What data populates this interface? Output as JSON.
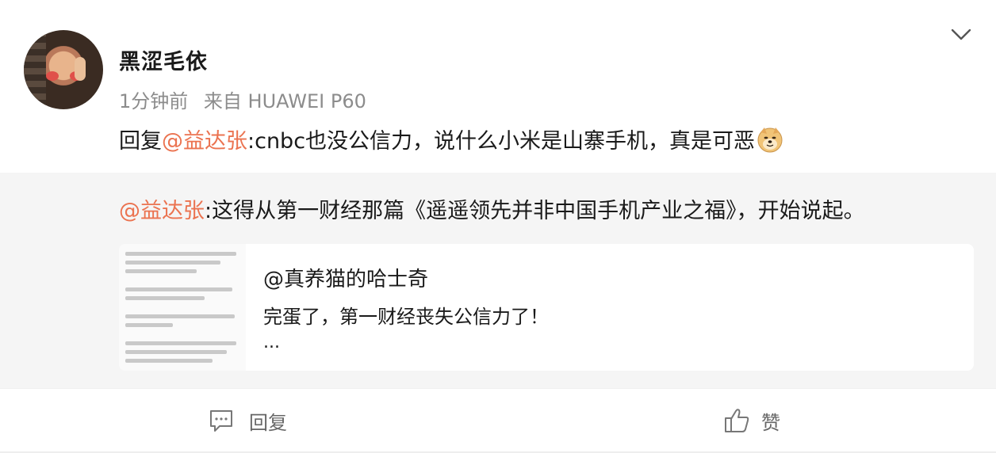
{
  "post": {
    "username": "黑涩毛依",
    "time": "1分钟前",
    "source": "来自 HUAWEI P60",
    "reply_prefix": "回复",
    "reply_mention": "@益达张",
    "reply_text": ":cnbc也没公信力，说什么小米是山寨手机，真是可恶",
    "emoji_icon": "doge-emoji-icon"
  },
  "quote": {
    "mention": "@益达张",
    "text": ":这得从第一财经那篇《遥遥领先并非中国手机产业之福》，开始说起。"
  },
  "card": {
    "author": "@真养猫的哈士奇",
    "text": "完蛋了，第一财经丧失公信力了！",
    "more": "..."
  },
  "actions": {
    "reply_label": "回复",
    "like_label": "赞"
  },
  "colors": {
    "mention": "#eb7350",
    "meta": "#8c8c8c",
    "quote_bg": "#f5f5f5"
  }
}
